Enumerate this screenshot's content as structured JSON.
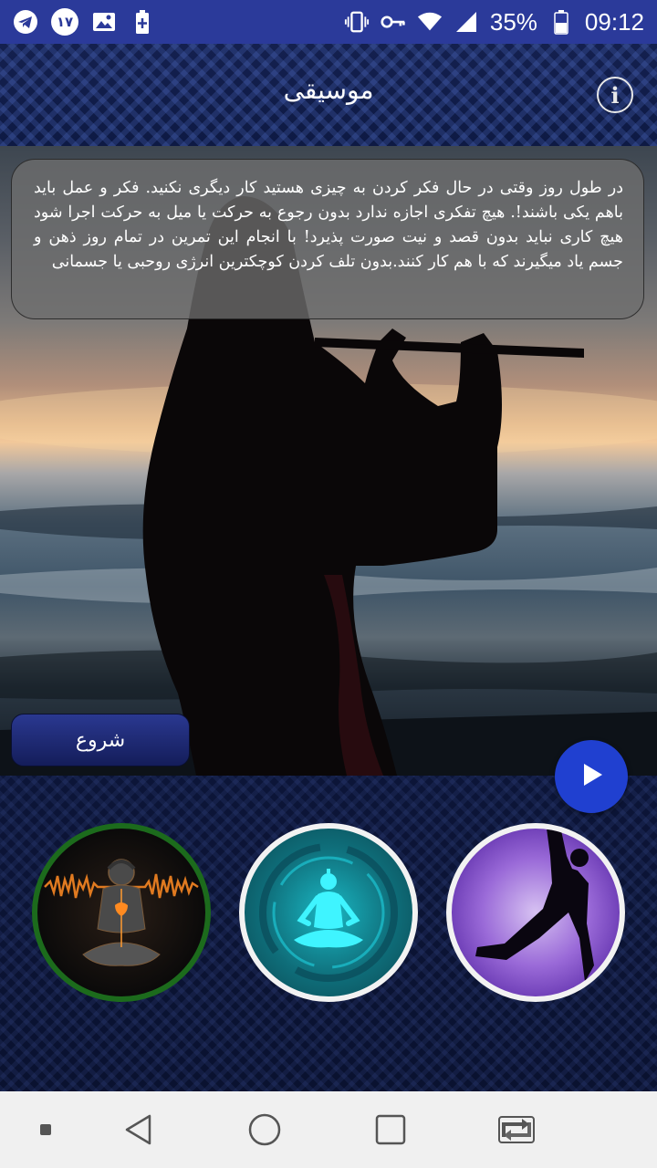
{
  "status_bar": {
    "badge": "۱۷",
    "battery": "35%",
    "time": "09:12"
  },
  "header": {
    "title": "موسیقی",
    "info_label": "i"
  },
  "description": {
    "text": "در طول روز وقتی در حال فکر کردن به چیزی هستید کار دیگری نکنید. فکر و عمل باید باهم یکی باشند!. هیچ تفکری اجازه ندارد بدون رجوع به حرکت یا میل به حرکت اجرا شود هیچ کاری نباید بدون قصد و نیت صورت پذیرد! با انجام این تمرین در تمام روز ذهن و جسم یاد میگیرند که با هم کار کنند.بدون تلف کردن کوچکترین انرژی روحبی یا جسمانی"
  },
  "start_button": {
    "label": "شروع"
  },
  "colors": {
    "status_bar": "#2b3a9a",
    "fab": "#2040d0",
    "start_button": "#1e2a78",
    "circle1_border": "#1c6b1c"
  },
  "icons": [
    "telegram-icon",
    "image-icon",
    "battery-plus-icon",
    "vibrate-icon",
    "key-icon",
    "wifi-icon",
    "signal-icon",
    "battery-icon",
    "info-icon",
    "play-icon",
    "back-icon",
    "home-icon",
    "recents-icon",
    "rotate-icon"
  ]
}
